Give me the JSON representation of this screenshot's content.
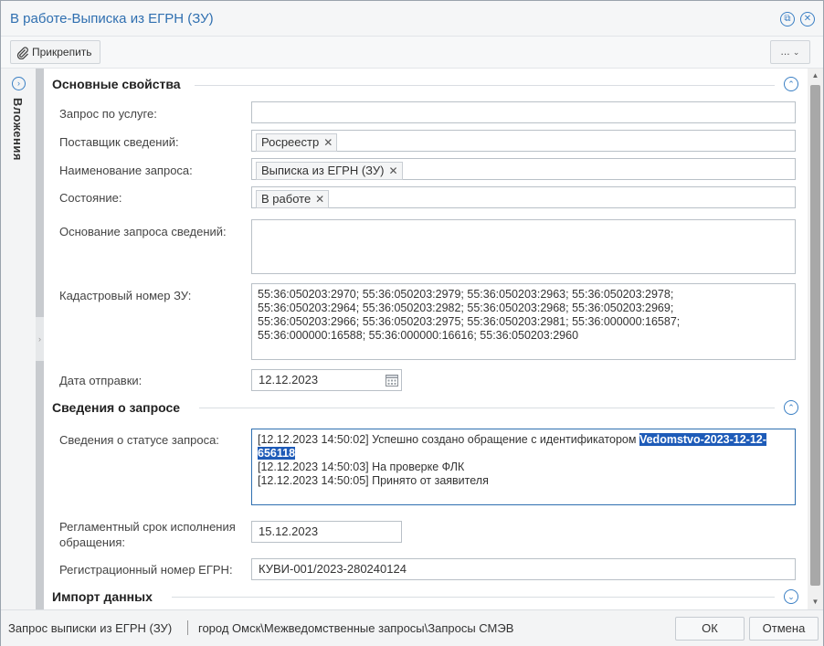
{
  "window": {
    "title": "В работе-Выписка из ЕГРН (ЗУ)"
  },
  "toolbar": {
    "attach_label": "Прикрепить",
    "more_label": "..."
  },
  "sidebar": {
    "tab_label": "Вложения"
  },
  "sections": {
    "main": "Основные свойства",
    "request": "Сведения о запросе",
    "import": "Импорт данных"
  },
  "fields": {
    "service_request": {
      "label": "Запрос по услуге:",
      "value": ""
    },
    "provider": {
      "label": "Поставщик сведений:",
      "value": "Росреестр"
    },
    "request_name": {
      "label": "Наименование запроса:",
      "value": "Выписка из ЕГРН (ЗУ)"
    },
    "state": {
      "label": "Состояние:",
      "value": "В работе"
    },
    "basis": {
      "label": "Основание запроса сведений:",
      "value": ""
    },
    "cadastral": {
      "label": "Кадастровый номер ЗУ:",
      "lines": [
        "55:36:050203:2970; 55:36:050203:2979; 55:36:050203:2963; 55:36:050203:2978;",
        "55:36:050203:2964; 55:36:050203:2982; 55:36:050203:2968; 55:36:050203:2969;",
        "55:36:050203:2966; 55:36:050203:2975; 55:36:050203:2981; 55:36:000000:16587;",
        "55:36:000000:16588; 55:36:000000:16616; 55:36:050203:2960"
      ]
    },
    "send_date": {
      "label": "Дата отправки:",
      "value": "12.12.2023"
    },
    "status_info": {
      "label": "Сведения о статусе запроса:",
      "line1_prefix": "[12.12.2023 14:50:02] Успешно создано обращение с идентификатором ",
      "line1_id_part1": "Vedomstvo-2023-12-12-",
      "line1_id_part2": "656118",
      "line2": "[12.12.2023 14:50:03] На проверке ФЛК",
      "line3": "[12.12.2023 14:50:05] Принято от заявителя"
    },
    "deadline": {
      "label_line1": "Регламентный срок исполнения",
      "label_line2": "обращения:",
      "value": "15.12.2023"
    },
    "reg_number": {
      "label": "Регистрационный номер ЕГРН:",
      "value": "КУВИ-001/2023-280240124"
    }
  },
  "footer": {
    "left_text": "Запрос выписки из ЕГРН (ЗУ)",
    "path_text": "город Омск\\Межведомственные запросы\\Запросы СМЭВ",
    "ok_label": "ОК",
    "cancel_label": "Отмена"
  },
  "colors": {
    "accent": "#2f6fb0",
    "highlight": "#1e5bb8"
  }
}
